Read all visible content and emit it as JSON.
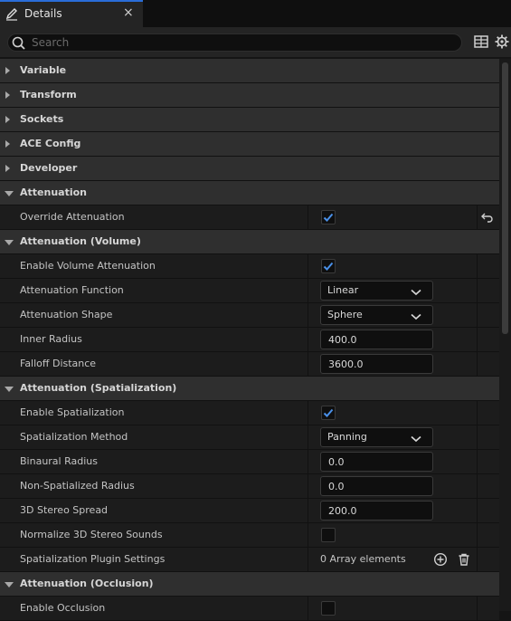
{
  "tab": {
    "title": "Details",
    "close": "×",
    "icon": "pencil-edit-icon"
  },
  "search": {
    "placeholder": "Search",
    "value": ""
  },
  "toolbar": {
    "icons": [
      "table-view-icon",
      "settings-gear-icon"
    ]
  },
  "colors": {
    "accent": "#2a6dd8",
    "checkmark": "#4a90e8"
  },
  "rows": [
    {
      "kind": "cat",
      "label": "Variable",
      "expanded": false
    },
    {
      "kind": "cat",
      "label": "Transform",
      "expanded": false
    },
    {
      "kind": "cat",
      "label": "Sockets",
      "expanded": false
    },
    {
      "kind": "cat",
      "label": "ACE Config",
      "expanded": false
    },
    {
      "kind": "cat",
      "label": "Developer",
      "expanded": false
    },
    {
      "kind": "cat",
      "label": "Attenuation",
      "expanded": true
    },
    {
      "kind": "prop",
      "label": "Override Attenuation",
      "control": "check",
      "checked": true,
      "reset": true
    },
    {
      "kind": "cat",
      "label": "Attenuation (Volume)",
      "expanded": true
    },
    {
      "kind": "prop",
      "label": "Enable Volume Attenuation",
      "control": "check",
      "checked": true
    },
    {
      "kind": "prop",
      "label": "Attenuation Function",
      "control": "combo",
      "value": "Linear"
    },
    {
      "kind": "prop",
      "label": "Attenuation Shape",
      "control": "combo",
      "value": "Sphere"
    },
    {
      "kind": "prop",
      "label": "Inner Radius",
      "control": "number",
      "value": "400.0"
    },
    {
      "kind": "prop",
      "label": "Falloff Distance",
      "control": "number",
      "value": "3600.0"
    },
    {
      "kind": "cat",
      "label": "Attenuation (Spatialization)",
      "expanded": true
    },
    {
      "kind": "prop",
      "label": "Enable Spatialization",
      "control": "check",
      "checked": true
    },
    {
      "kind": "prop",
      "label": "Spatialization Method",
      "control": "combo",
      "value": "Panning"
    },
    {
      "kind": "prop",
      "label": "Binaural Radius",
      "control": "number",
      "value": "0.0"
    },
    {
      "kind": "prop",
      "label": "Non-Spatialized Radius",
      "control": "number",
      "value": "0.0"
    },
    {
      "kind": "prop",
      "label": "3D Stereo Spread",
      "control": "number",
      "value": "200.0"
    },
    {
      "kind": "prop",
      "label": "Normalize 3D Stereo Sounds",
      "control": "check",
      "checked": false
    },
    {
      "kind": "prop",
      "label": "Spatialization Plugin Settings",
      "control": "array",
      "value": "0 Array elements"
    },
    {
      "kind": "cat",
      "label": "Attenuation (Occlusion)",
      "expanded": true
    },
    {
      "kind": "prop",
      "label": "Enable Occlusion",
      "control": "check",
      "checked": false
    }
  ]
}
